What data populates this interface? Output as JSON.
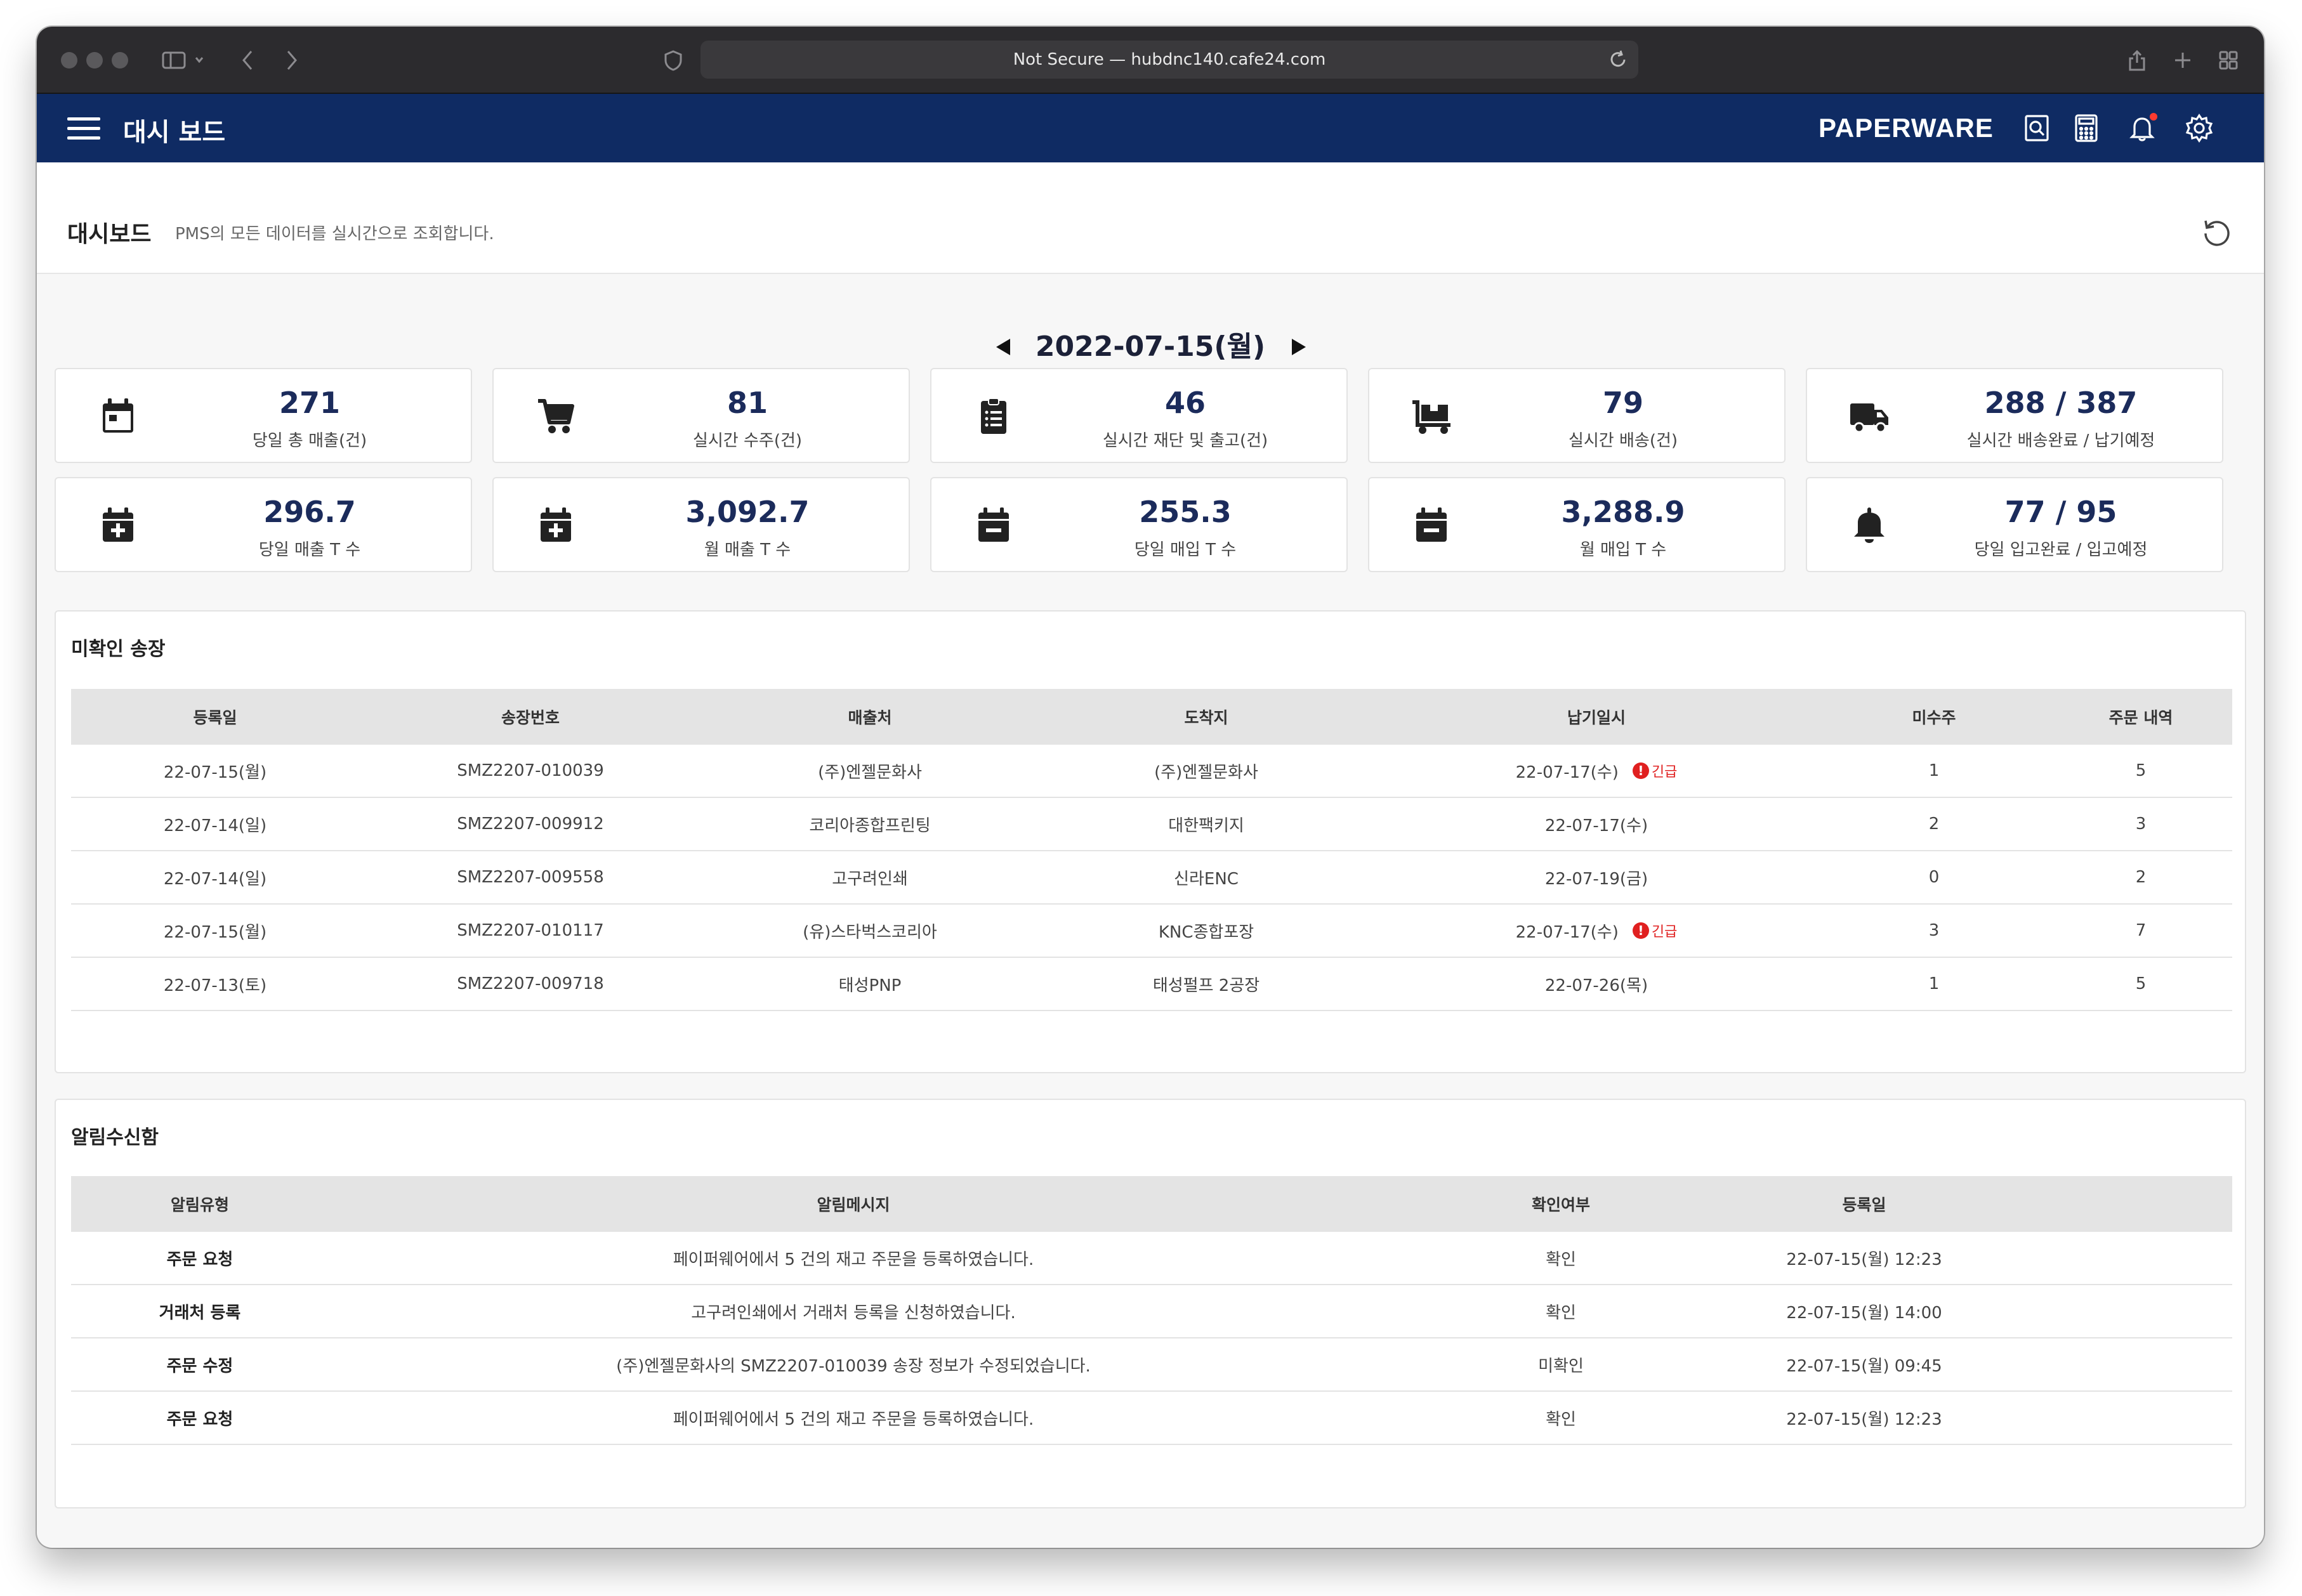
{
  "browser": {
    "url_text": "Not Secure — hubdnc140.cafe24.com"
  },
  "appbar": {
    "title": "대시 보드",
    "brand": "PAPERWARE",
    "icons": [
      "search-doc-icon",
      "calculator-icon",
      "bell-icon",
      "gear-icon"
    ],
    "accent_color": "#0f2b63",
    "notification_dot_color": "#ff3b30"
  },
  "page": {
    "title": "대시보드",
    "description": "PMS의 모든 데이터를 실시간으로 조회합니다."
  },
  "date_nav": {
    "current": "2022-07-15(월)"
  },
  "stats": [
    {
      "value": "271",
      "label": "당일 총 매출(건)",
      "icon": "calendar-icon"
    },
    {
      "value": "81",
      "label": "실시간 수주(건)",
      "icon": "cart-icon"
    },
    {
      "value": "46",
      "label": "실시간 재단 및 출고(건)",
      "icon": "clipboard-list-icon"
    },
    {
      "value": "79",
      "label": "실시간 배송(건)",
      "icon": "dolly-icon"
    },
    {
      "value": "288 / 387",
      "label": "실시간 배송완료 / 납기예정",
      "icon": "truck-icon"
    },
    {
      "value": "296.7",
      "label": "당일 매출 T 수",
      "icon": "calendar-plus-icon"
    },
    {
      "value": "3,092.7",
      "label": "월 매출 T 수",
      "icon": "calendar-plus-icon"
    },
    {
      "value": "255.3",
      "label": "당일 매입 T 수",
      "icon": "calendar-minus-icon"
    },
    {
      "value": "3,288.9",
      "label": "월 매입 T 수",
      "icon": "calendar-minus-icon"
    },
    {
      "value": "77 / 95",
      "label": "당일 입고완료 / 입고예정",
      "icon": "bell-icon"
    }
  ],
  "invoices": {
    "title": "미확인 송장",
    "columns": [
      "등록일",
      "송장번호",
      "매출처",
      "도착지",
      "납기일시",
      "미수주",
      "주문 내역"
    ],
    "urgent_label": "긴급",
    "urgent_color": "#e02020",
    "rows": [
      {
        "date": "22-07-15(월)",
        "invoice_no": "SMZ2207-010039",
        "seller": "(주)엔젤문화사",
        "destination": "(주)엔젤문화사",
        "due": "22-07-17(수)",
        "urgent": true,
        "unreceived": "1",
        "orders": "5"
      },
      {
        "date": "22-07-14(일)",
        "invoice_no": "SMZ2207-009912",
        "seller": "코리아종합프린팅",
        "destination": "대한팩키지",
        "due": "22-07-17(수)",
        "urgent": false,
        "unreceived": "2",
        "orders": "3"
      },
      {
        "date": "22-07-14(일)",
        "invoice_no": "SMZ2207-009558",
        "seller": "고구려인쇄",
        "destination": "신라ENC",
        "due": "22-07-19(금)",
        "urgent": false,
        "unreceived": "0",
        "orders": "2"
      },
      {
        "date": "22-07-15(월)",
        "invoice_no": "SMZ2207-010117",
        "seller": "(유)스타벅스코리아",
        "destination": "KNC종합포장",
        "due": "22-07-17(수)",
        "urgent": true,
        "unreceived": "3",
        "orders": "7"
      },
      {
        "date": "22-07-13(토)",
        "invoice_no": "SMZ2207-009718",
        "seller": "태성PNP",
        "destination": "태성펄프 2공장",
        "due": "22-07-26(목)",
        "urgent": false,
        "unreceived": "1",
        "orders": "5"
      }
    ]
  },
  "alerts": {
    "title": "알림수신함",
    "columns": [
      "알림유형",
      "알림메시지",
      "확인여부",
      "등록일"
    ],
    "rows": [
      {
        "type": "주문 요청",
        "message": "페이퍼웨어에서 5 건의 재고 주문을 등록하였습니다.",
        "status": "확인",
        "date": "22-07-15(월) 12:23"
      },
      {
        "type": "거래처 등록",
        "message": "고구려인쇄에서 거래처 등록을 신청하였습니다.",
        "status": "확인",
        "date": "22-07-15(월) 14:00"
      },
      {
        "type": "주문 수정",
        "message": "(주)엔젤문화사의 SMZ2207-010039 송장 정보가 수정되었습니다.",
        "status": "미확인",
        "date": "22-07-15(월) 09:45"
      },
      {
        "type": "주문 요청",
        "message": "페이퍼웨어에서 5 건의 재고 주문을 등록하였습니다.",
        "status": "확인",
        "date": "22-07-15(월) 12:23"
      }
    ]
  }
}
